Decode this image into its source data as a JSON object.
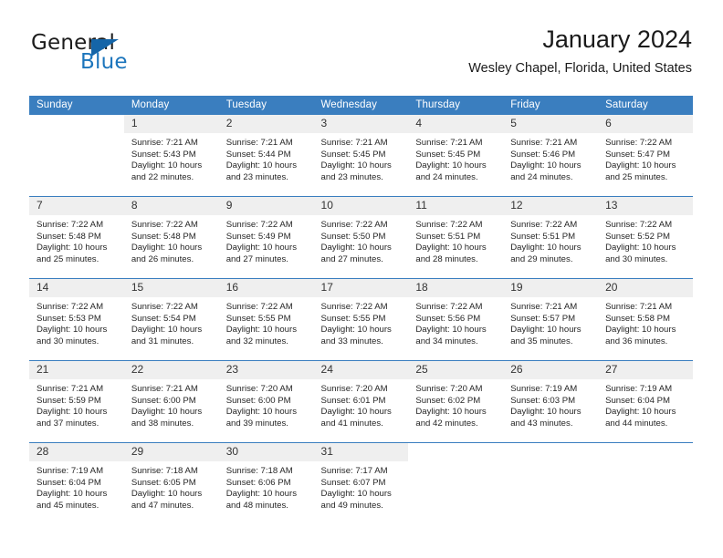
{
  "brand": {
    "name_part1": "General",
    "name_part2": "Blue",
    "accent_color": "#1c75bc"
  },
  "header": {
    "title": "January 2024",
    "location": "Wesley Chapel, Florida, United States"
  },
  "calendar": {
    "header_color": "#3a7ebf",
    "daynum_background": "#efefef",
    "weekdays": [
      "Sunday",
      "Monday",
      "Tuesday",
      "Wednesday",
      "Thursday",
      "Friday",
      "Saturday"
    ],
    "weeks": [
      [
        {
          "day": "",
          "sunrise": "",
          "sunset": "",
          "daylight_line1": "",
          "daylight_line2": "",
          "empty": true
        },
        {
          "day": "1",
          "sunrise": "Sunrise: 7:21 AM",
          "sunset": "Sunset: 5:43 PM",
          "daylight_line1": "Daylight: 10 hours",
          "daylight_line2": "and 22 minutes."
        },
        {
          "day": "2",
          "sunrise": "Sunrise: 7:21 AM",
          "sunset": "Sunset: 5:44 PM",
          "daylight_line1": "Daylight: 10 hours",
          "daylight_line2": "and 23 minutes."
        },
        {
          "day": "3",
          "sunrise": "Sunrise: 7:21 AM",
          "sunset": "Sunset: 5:45 PM",
          "daylight_line1": "Daylight: 10 hours",
          "daylight_line2": "and 23 minutes."
        },
        {
          "day": "4",
          "sunrise": "Sunrise: 7:21 AM",
          "sunset": "Sunset: 5:45 PM",
          "daylight_line1": "Daylight: 10 hours",
          "daylight_line2": "and 24 minutes."
        },
        {
          "day": "5",
          "sunrise": "Sunrise: 7:21 AM",
          "sunset": "Sunset: 5:46 PM",
          "daylight_line1": "Daylight: 10 hours",
          "daylight_line2": "and 24 minutes."
        },
        {
          "day": "6",
          "sunrise": "Sunrise: 7:22 AM",
          "sunset": "Sunset: 5:47 PM",
          "daylight_line1": "Daylight: 10 hours",
          "daylight_line2": "and 25 minutes."
        }
      ],
      [
        {
          "day": "7",
          "sunrise": "Sunrise: 7:22 AM",
          "sunset": "Sunset: 5:48 PM",
          "daylight_line1": "Daylight: 10 hours",
          "daylight_line2": "and 25 minutes."
        },
        {
          "day": "8",
          "sunrise": "Sunrise: 7:22 AM",
          "sunset": "Sunset: 5:48 PM",
          "daylight_line1": "Daylight: 10 hours",
          "daylight_line2": "and 26 minutes."
        },
        {
          "day": "9",
          "sunrise": "Sunrise: 7:22 AM",
          "sunset": "Sunset: 5:49 PM",
          "daylight_line1": "Daylight: 10 hours",
          "daylight_line2": "and 27 minutes."
        },
        {
          "day": "10",
          "sunrise": "Sunrise: 7:22 AM",
          "sunset": "Sunset: 5:50 PM",
          "daylight_line1": "Daylight: 10 hours",
          "daylight_line2": "and 27 minutes."
        },
        {
          "day": "11",
          "sunrise": "Sunrise: 7:22 AM",
          "sunset": "Sunset: 5:51 PM",
          "daylight_line1": "Daylight: 10 hours",
          "daylight_line2": "and 28 minutes."
        },
        {
          "day": "12",
          "sunrise": "Sunrise: 7:22 AM",
          "sunset": "Sunset: 5:51 PM",
          "daylight_line1": "Daylight: 10 hours",
          "daylight_line2": "and 29 minutes."
        },
        {
          "day": "13",
          "sunrise": "Sunrise: 7:22 AM",
          "sunset": "Sunset: 5:52 PM",
          "daylight_line1": "Daylight: 10 hours",
          "daylight_line2": "and 30 minutes."
        }
      ],
      [
        {
          "day": "14",
          "sunrise": "Sunrise: 7:22 AM",
          "sunset": "Sunset: 5:53 PM",
          "daylight_line1": "Daylight: 10 hours",
          "daylight_line2": "and 30 minutes."
        },
        {
          "day": "15",
          "sunrise": "Sunrise: 7:22 AM",
          "sunset": "Sunset: 5:54 PM",
          "daylight_line1": "Daylight: 10 hours",
          "daylight_line2": "and 31 minutes."
        },
        {
          "day": "16",
          "sunrise": "Sunrise: 7:22 AM",
          "sunset": "Sunset: 5:55 PM",
          "daylight_line1": "Daylight: 10 hours",
          "daylight_line2": "and 32 minutes."
        },
        {
          "day": "17",
          "sunrise": "Sunrise: 7:22 AM",
          "sunset": "Sunset: 5:55 PM",
          "daylight_line1": "Daylight: 10 hours",
          "daylight_line2": "and 33 minutes."
        },
        {
          "day": "18",
          "sunrise": "Sunrise: 7:22 AM",
          "sunset": "Sunset: 5:56 PM",
          "daylight_line1": "Daylight: 10 hours",
          "daylight_line2": "and 34 minutes."
        },
        {
          "day": "19",
          "sunrise": "Sunrise: 7:21 AM",
          "sunset": "Sunset: 5:57 PM",
          "daylight_line1": "Daylight: 10 hours",
          "daylight_line2": "and 35 minutes."
        },
        {
          "day": "20",
          "sunrise": "Sunrise: 7:21 AM",
          "sunset": "Sunset: 5:58 PM",
          "daylight_line1": "Daylight: 10 hours",
          "daylight_line2": "and 36 minutes."
        }
      ],
      [
        {
          "day": "21",
          "sunrise": "Sunrise: 7:21 AM",
          "sunset": "Sunset: 5:59 PM",
          "daylight_line1": "Daylight: 10 hours",
          "daylight_line2": "and 37 minutes."
        },
        {
          "day": "22",
          "sunrise": "Sunrise: 7:21 AM",
          "sunset": "Sunset: 6:00 PM",
          "daylight_line1": "Daylight: 10 hours",
          "daylight_line2": "and 38 minutes."
        },
        {
          "day": "23",
          "sunrise": "Sunrise: 7:20 AM",
          "sunset": "Sunset: 6:00 PM",
          "daylight_line1": "Daylight: 10 hours",
          "daylight_line2": "and 39 minutes."
        },
        {
          "day": "24",
          "sunrise": "Sunrise: 7:20 AM",
          "sunset": "Sunset: 6:01 PM",
          "daylight_line1": "Daylight: 10 hours",
          "daylight_line2": "and 41 minutes."
        },
        {
          "day": "25",
          "sunrise": "Sunrise: 7:20 AM",
          "sunset": "Sunset: 6:02 PM",
          "daylight_line1": "Daylight: 10 hours",
          "daylight_line2": "and 42 minutes."
        },
        {
          "day": "26",
          "sunrise": "Sunrise: 7:19 AM",
          "sunset": "Sunset: 6:03 PM",
          "daylight_line1": "Daylight: 10 hours",
          "daylight_line2": "and 43 minutes."
        },
        {
          "day": "27",
          "sunrise": "Sunrise: 7:19 AM",
          "sunset": "Sunset: 6:04 PM",
          "daylight_line1": "Daylight: 10 hours",
          "daylight_line2": "and 44 minutes."
        }
      ],
      [
        {
          "day": "28",
          "sunrise": "Sunrise: 7:19 AM",
          "sunset": "Sunset: 6:04 PM",
          "daylight_line1": "Daylight: 10 hours",
          "daylight_line2": "and 45 minutes."
        },
        {
          "day": "29",
          "sunrise": "Sunrise: 7:18 AM",
          "sunset": "Sunset: 6:05 PM",
          "daylight_line1": "Daylight: 10 hours",
          "daylight_line2": "and 47 minutes."
        },
        {
          "day": "30",
          "sunrise": "Sunrise: 7:18 AM",
          "sunset": "Sunset: 6:06 PM",
          "daylight_line1": "Daylight: 10 hours",
          "daylight_line2": "and 48 minutes."
        },
        {
          "day": "31",
          "sunrise": "Sunrise: 7:17 AM",
          "sunset": "Sunset: 6:07 PM",
          "daylight_line1": "Daylight: 10 hours",
          "daylight_line2": "and 49 minutes."
        },
        {
          "day": "",
          "sunrise": "",
          "sunset": "",
          "daylight_line1": "",
          "daylight_line2": "",
          "empty": true
        },
        {
          "day": "",
          "sunrise": "",
          "sunset": "",
          "daylight_line1": "",
          "daylight_line2": "",
          "empty": true
        },
        {
          "day": "",
          "sunrise": "",
          "sunset": "",
          "daylight_line1": "",
          "daylight_line2": "",
          "empty": true
        }
      ]
    ]
  }
}
